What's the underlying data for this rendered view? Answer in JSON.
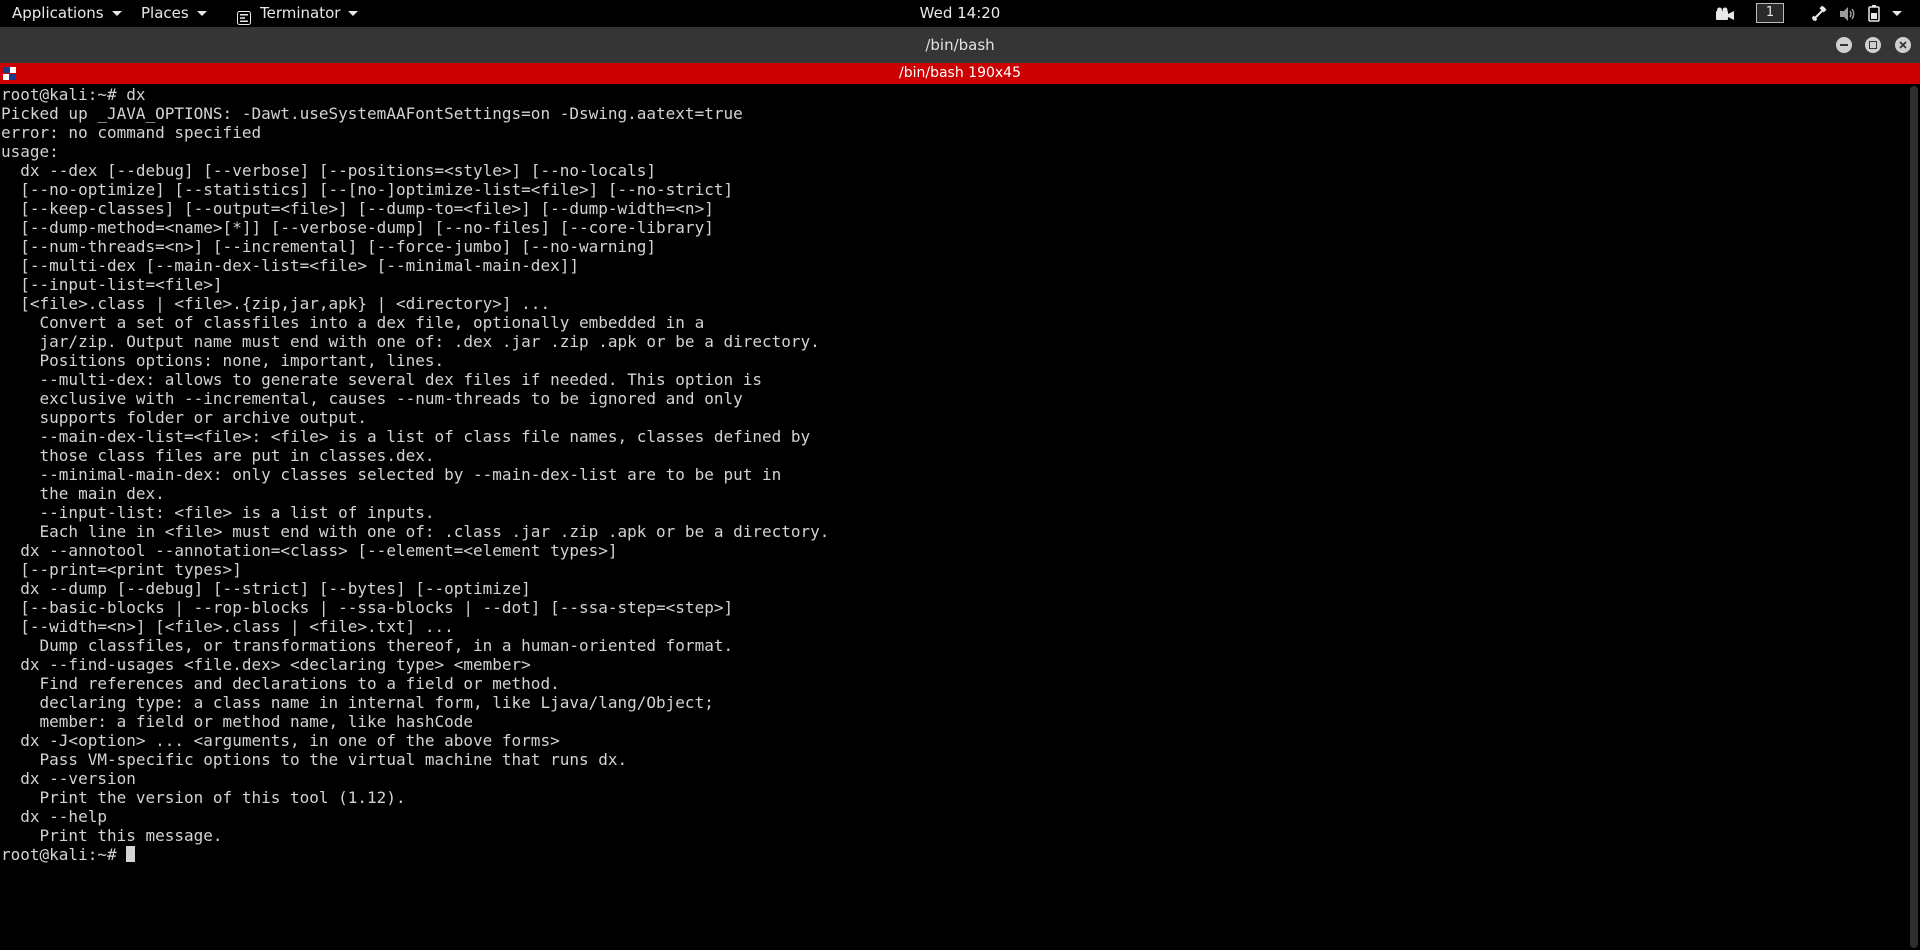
{
  "top_panel": {
    "applications_label": "Applications",
    "places_label": "Places",
    "terminator_label": "Terminator",
    "clock": "Wed 14:20",
    "workspace_number": "1"
  },
  "window": {
    "title": "/bin/bash"
  },
  "terminal_titlebar": {
    "title": "/bin/bash 190x45"
  },
  "terminal": {
    "lines": [
      "root@kali:~# dx",
      "Picked up _JAVA_OPTIONS: -Dawt.useSystemAAFontSettings=on -Dswing.aatext=true",
      "error: no command specified",
      "usage:",
      "  dx --dex [--debug] [--verbose] [--positions=<style>] [--no-locals]",
      "  [--no-optimize] [--statistics] [--[no-]optimize-list=<file>] [--no-strict]",
      "  [--keep-classes] [--output=<file>] [--dump-to=<file>] [--dump-width=<n>]",
      "  [--dump-method=<name>[*]] [--verbose-dump] [--no-files] [--core-library]",
      "  [--num-threads=<n>] [--incremental] [--force-jumbo] [--no-warning]",
      "  [--multi-dex [--main-dex-list=<file> [--minimal-main-dex]]",
      "  [--input-list=<file>]",
      "  [<file>.class | <file>.{zip,jar,apk} | <directory>] ...",
      "    Convert a set of classfiles into a dex file, optionally embedded in a",
      "    jar/zip. Output name must end with one of: .dex .jar .zip .apk or be a directory.",
      "    Positions options: none, important, lines.",
      "    --multi-dex: allows to generate several dex files if needed. This option is",
      "    exclusive with --incremental, causes --num-threads to be ignored and only",
      "    supports folder or archive output.",
      "    --main-dex-list=<file>: <file> is a list of class file names, classes defined by",
      "    those class files are put in classes.dex.",
      "    --minimal-main-dex: only classes selected by --main-dex-list are to be put in",
      "    the main dex.",
      "    --input-list: <file> is a list of inputs.",
      "    Each line in <file> must end with one of: .class .jar .zip .apk or be a directory.",
      "  dx --annotool --annotation=<class> [--element=<element types>]",
      "  [--print=<print types>]",
      "  dx --dump [--debug] [--strict] [--bytes] [--optimize]",
      "  [--basic-blocks | --rop-blocks | --ssa-blocks | --dot] [--ssa-step=<step>]",
      "  [--width=<n>] [<file>.class | <file>.txt] ...",
      "    Dump classfiles, or transformations thereof, in a human-oriented format.",
      "  dx --find-usages <file.dex> <declaring type> <member>",
      "    Find references and declarations to a field or method.",
      "    declaring type: a class name in internal form, like Ljava/lang/Object;",
      "    member: a field or method name, like hashCode",
      "  dx -J<option> ... <arguments, in one of the above forms>",
      "    Pass VM-specific options to the virtual machine that runs dx.",
      "  dx --version",
      "    Print the version of this tool (1.12).",
      "  dx --help",
      "    Print this message."
    ],
    "prompt": "root@kali:~# "
  },
  "colors": {
    "terminal_titlebar": "#cc0000",
    "window_titlebar": "#353535",
    "terminal_bg": "#000000",
    "terminal_fg": "#d3d3d3"
  }
}
